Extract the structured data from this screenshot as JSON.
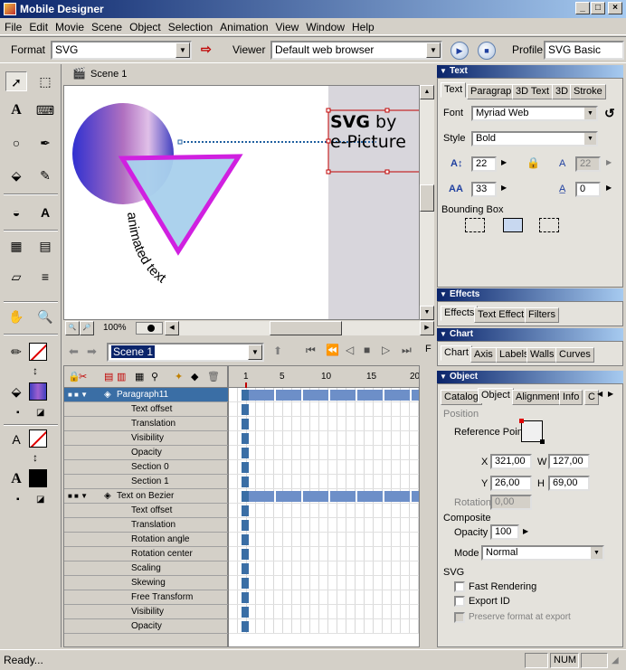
{
  "app": {
    "title": "Mobile Designer"
  },
  "menu": [
    "File",
    "Edit",
    "Movie",
    "Scene",
    "Object",
    "Selection",
    "Animation",
    "View",
    "Window",
    "Help"
  ],
  "toolbar": {
    "format_label": "Format",
    "format_value": "SVG",
    "viewer_label": "Viewer",
    "viewer_value": "Default web browser",
    "profile_label": "Profile",
    "profile_value": "SVG Basic"
  },
  "scene": {
    "tab_label": "Scene 1",
    "canvas_text_line1": "SVG",
    "canvas_text_line1b": "by",
    "canvas_text_line2": "e-Picture",
    "path_text": "animated text"
  },
  "zoom": {
    "value": "100%"
  },
  "timeline": {
    "scene_select": "Scene 1",
    "ruler": [
      "1",
      "5",
      "10",
      "15",
      "20"
    ],
    "layers": [
      {
        "name": "Paragraph11",
        "selected": true,
        "level": 0
      },
      {
        "name": "Text offset",
        "level": 1
      },
      {
        "name": "Translation",
        "level": 1
      },
      {
        "name": "Visibility",
        "level": 1
      },
      {
        "name": "Opacity",
        "level": 1
      },
      {
        "name": "Section 0",
        "level": 1
      },
      {
        "name": "Section 1",
        "level": 1
      },
      {
        "name": "Text on Bezier",
        "level": 0
      },
      {
        "name": "Text offset",
        "level": 1
      },
      {
        "name": "Translation",
        "level": 1
      },
      {
        "name": "Rotation angle",
        "level": 1
      },
      {
        "name": "Rotation center",
        "level": 1
      },
      {
        "name": "Scaling",
        "level": 1
      },
      {
        "name": "Skewing",
        "level": 1
      },
      {
        "name": "Free Transform",
        "level": 1
      },
      {
        "name": "Visibility",
        "level": 1
      },
      {
        "name": "Opacity",
        "level": 1
      }
    ]
  },
  "text_panel": {
    "title": "Text",
    "tabs": [
      "Text",
      "Paragraph",
      "3D Text",
      "3D",
      "Stroke"
    ],
    "font_label": "Font",
    "font_value": "Myriad Web",
    "style_label": "Style",
    "style_value": "Bold",
    "size_value": "22",
    "leading_value": "33",
    "kerning_value": "22",
    "tracking_value": "0",
    "bbox_label": "Bounding Box"
  },
  "effects_panel": {
    "title": "Effects",
    "tabs": [
      "Effects",
      "Text Effect",
      "Filters"
    ]
  },
  "chart_panel": {
    "title": "Chart",
    "tabs": [
      "Chart",
      "Axis",
      "Labels",
      "Walls",
      "Curves"
    ]
  },
  "object_panel": {
    "title": "Object",
    "tabs": [
      "Catalog",
      "Object",
      "Alignment",
      "Info",
      "C"
    ],
    "position_label": "Position",
    "ref_point_label": "Reference Point",
    "x_label": "X",
    "x_value": "321,00",
    "w_label": "W",
    "w_value": "127,00",
    "y_label": "Y",
    "y_value": "26,00",
    "h_label": "H",
    "h_value": "69,00",
    "rotation_label": "Rotation",
    "rotation_value": "0,00",
    "composite_label": "Composite",
    "opacity_label": "Opacity",
    "opacity_value": "100",
    "mode_label": "Mode",
    "mode_value": "Normal",
    "svg_label": "SVG",
    "fast_rendering": "Fast Rendering",
    "export_id": "Export ID",
    "preserve_format": "Preserve format at export"
  },
  "status": {
    "text": "Ready...",
    "num": "NUM"
  }
}
